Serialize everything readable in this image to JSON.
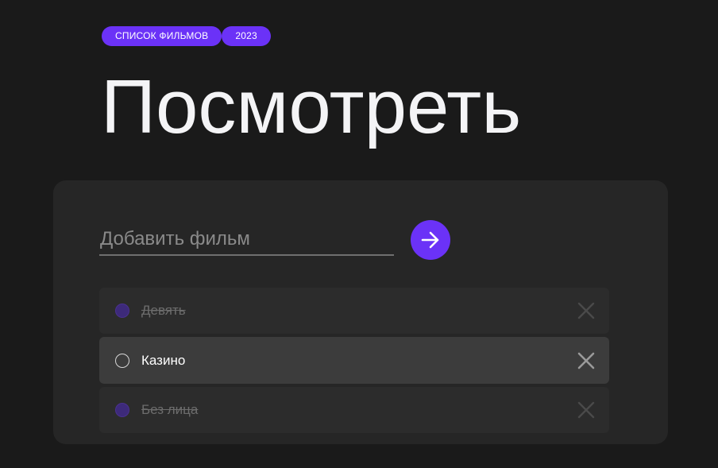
{
  "header": {
    "tags": [
      "СПИСОК ФИЛЬМОВ",
      "2023"
    ],
    "title": "Посмотреть"
  },
  "form": {
    "placeholder": "Добавить фильм",
    "submit_icon": "arrow-right-icon"
  },
  "movies": [
    {
      "title": "Девять",
      "watched": true
    },
    {
      "title": "Казино",
      "watched": false
    },
    {
      "title": "Без лица",
      "watched": true
    }
  ],
  "colors": {
    "background": "#1a1a1a",
    "card": "#262626",
    "accent": "#6b32f7",
    "item": "#2c2c2c",
    "item_active": "#3c3c3c"
  },
  "icons": {
    "delete": "close-icon",
    "status": "circle-checkbox-icon"
  }
}
